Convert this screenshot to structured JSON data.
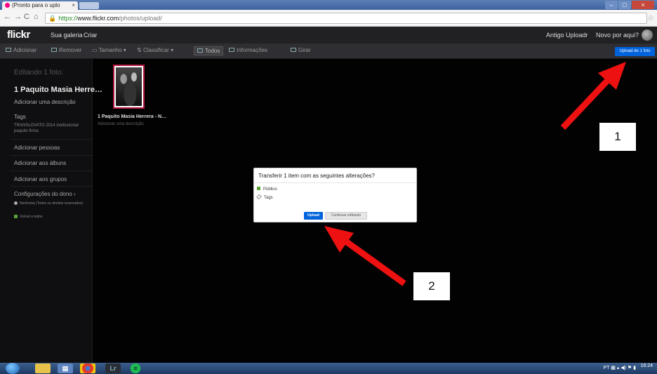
{
  "browser": {
    "tab_title": "(Pronto para o uplo",
    "url_scheme": "https://",
    "url_host": "www.flickr.com",
    "url_path": "/photos/upload/"
  },
  "header": {
    "logo": "flickr",
    "nav": [
      "Sua galeria",
      "Criar"
    ],
    "right_links": [
      "Antigo Uploadr",
      "Novo por aqui?"
    ]
  },
  "toolbar": {
    "add": "Adicionar",
    "remove": "Remover",
    "size": "Tamanho",
    "sort": "Classificar",
    "all": "Todos",
    "info": "Informações",
    "rotate": "Girar",
    "upload_button": "Upload de 1 foto"
  },
  "sidebar": {
    "editing": "Editando 1 foto:",
    "photo_title": "1 Paquito Masia Herre…",
    "add_description": "Adicionar uma descrição",
    "tags_label": "Tags",
    "tags_value": "TRANSLOVATO 2014 institucional paquito firma",
    "add_people": "Adicionar pessoas",
    "add_albums": "Adicionar aos álbuns",
    "add_groups": "Adicionar aos grupos",
    "owner_settings": "Configurações do dono",
    "license": "Nenhuma (Todos os direitos reservados)",
    "visibility": "Visível a todos"
  },
  "photo": {
    "title": "1 Paquito Masia Herrera - N…",
    "description": "Adicionar uma descrição"
  },
  "dialog": {
    "title": "Transferir 1 item com as seguintes alterações?",
    "rows": [
      "Público",
      "Tags"
    ],
    "upload": "Upload",
    "continue": "Continuar editando"
  },
  "annotations": [
    "1",
    "2"
  ],
  "colors": {
    "flickr_blue": "#0063dc",
    "flickr_pink": "#ff0084",
    "arrow_red": "#ee1111"
  },
  "taskbar": {
    "lang": "PT",
    "time": "16:24",
    "apps": [
      "Lr"
    ]
  }
}
